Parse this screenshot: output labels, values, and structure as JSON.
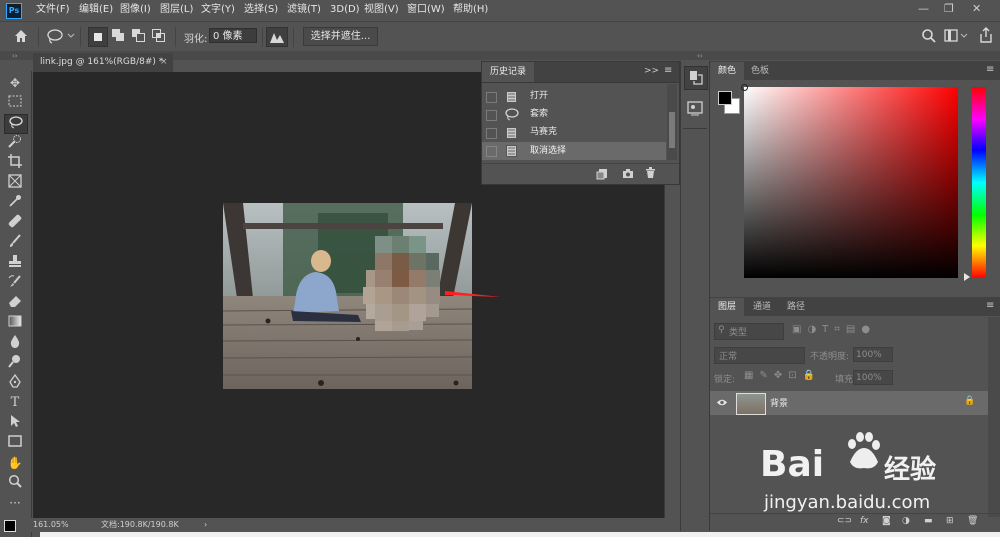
{
  "app_logo": "Ps",
  "menus": [
    "文件(F)",
    "编辑(E)",
    "图像(I)",
    "图层(L)",
    "文字(Y)",
    "选择(S)",
    "滤镜(T)",
    "3D(D)",
    "视图(V)",
    "窗口(W)",
    "帮助(H)"
  ],
  "window_controls": [
    "—",
    "❐",
    "✕"
  ],
  "options": {
    "feather_label": "羽化:",
    "feather_value": "0 像素",
    "select_mask_button": "选择并遮住..."
  },
  "document_tab": {
    "title": "link.jpg @ 161%(RGB/8#) *",
    "close": "×"
  },
  "status": {
    "zoom": "161.05%",
    "doc": "文档:190.8K/190.8K",
    "arrow": "›"
  },
  "history_panel": {
    "title": "历史记录",
    "items": [
      {
        "label": "打开"
      },
      {
        "label": "套索"
      },
      {
        "label": "马赛克"
      },
      {
        "label": "取消选择"
      }
    ]
  },
  "color_panel": {
    "tabs": [
      "颜色",
      "色板"
    ],
    "foreground": "#000000",
    "background": "#ffffff",
    "hue_base": "#ff0000"
  },
  "layers_panel": {
    "tabs": [
      "图层",
      "通道",
      "路径"
    ],
    "filter_placeholder": "类型",
    "blend_mode": "正常",
    "opacity_label": "不透明度:",
    "opacity_value": "100%",
    "lock_label": "锁定:",
    "fill_label": "填充:",
    "fill_value": "100%",
    "layer_name": "背景"
  },
  "watermark": {
    "line1": "Bai",
    "line1b": "经验",
    "line2": "jingyan.baidu.com"
  }
}
